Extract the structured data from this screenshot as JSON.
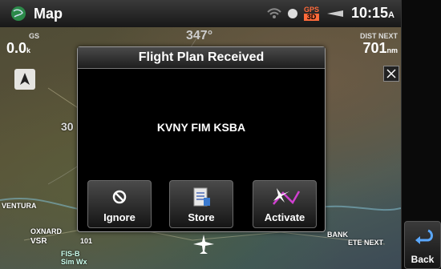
{
  "app": {
    "title": "Map",
    "time": "10:15",
    "time_suffix": "A",
    "gps_top": "GPS",
    "gps_bottom": "3D"
  },
  "data_fields": {
    "gs_label": "GS",
    "gs_value": "0.0",
    "gs_unit": "k",
    "track_value": "347°",
    "dist_label": "DIST NEXT",
    "dist_value": "701",
    "dist_unit": "nm"
  },
  "map_labels": {
    "ventura": "VENTURA",
    "oxnard": "OXNARD",
    "vsr": "VSR",
    "fisb": "FIS-B",
    "sim_wx": "Sim Wx",
    "bank": "BANK",
    "ete_next": "ETE NEXT",
    "thirty": "30",
    "label_101": "101"
  },
  "dialog": {
    "title": "Flight Plan Received",
    "route": "KVNY FIM KSBA",
    "buttons": [
      {
        "label": "Ignore",
        "icon": "ignore-icon"
      },
      {
        "label": "Store",
        "icon": "store-icon"
      },
      {
        "label": "Activate",
        "icon": "activate-icon"
      }
    ]
  },
  "sidebar": {
    "back_label": "Back",
    "icon": "back-arrow-icon"
  },
  "colors": {
    "gps_warn": "#ff6a3a",
    "activate_magenta": "#d040d0",
    "ignore_blue": "#6aa8ff"
  }
}
